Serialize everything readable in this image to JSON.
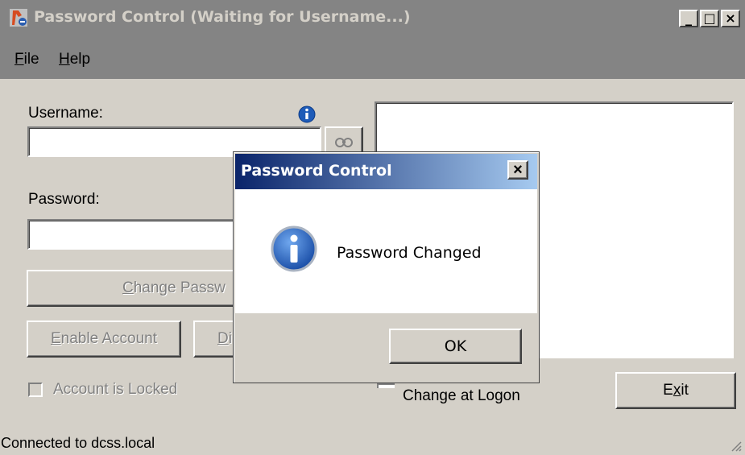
{
  "window": {
    "title": "Password Control  (Waiting for Username...)",
    "controls": {
      "minimize": "_",
      "maximize": "□",
      "close": "×"
    }
  },
  "menu": [
    {
      "label": "File",
      "accel": "F",
      "rest": "ile"
    },
    {
      "label": "Help",
      "accel": "H",
      "rest": "elp"
    }
  ],
  "form": {
    "username_label": "Username:",
    "username_value": "",
    "password_label": "Password:",
    "password_value": "",
    "change_password_button": {
      "accel": "C",
      "rest": "hange Passw"
    },
    "enable_account_button": {
      "accel": "E",
      "rest": "nable Account"
    },
    "disable_account_button": {
      "accel": "D",
      "rest": "i"
    },
    "account_locked_label": "Account is Locked",
    "account_locked_checked": false,
    "change_at_logon_label": "Change at Logon",
    "exit_button": {
      "pre": "E",
      "accel": "x",
      "rest": "it"
    }
  },
  "status_bar": {
    "text": "Connected to dcss.local"
  },
  "dialog": {
    "title": "Password Control",
    "message": "Password Changed",
    "ok_label": "OK",
    "close_glyph": "×"
  },
  "colors": {
    "chrome": "#d4d0c8",
    "title_inactive": "#848484",
    "dialog_title_start": "#0a246a",
    "dialog_title_end": "#a6caf0",
    "info_blue": "#1e5bb8"
  },
  "icons": [
    "app-icon",
    "info-icon",
    "lookup-icon",
    "info-large-icon",
    "resize-grip-icon"
  ]
}
